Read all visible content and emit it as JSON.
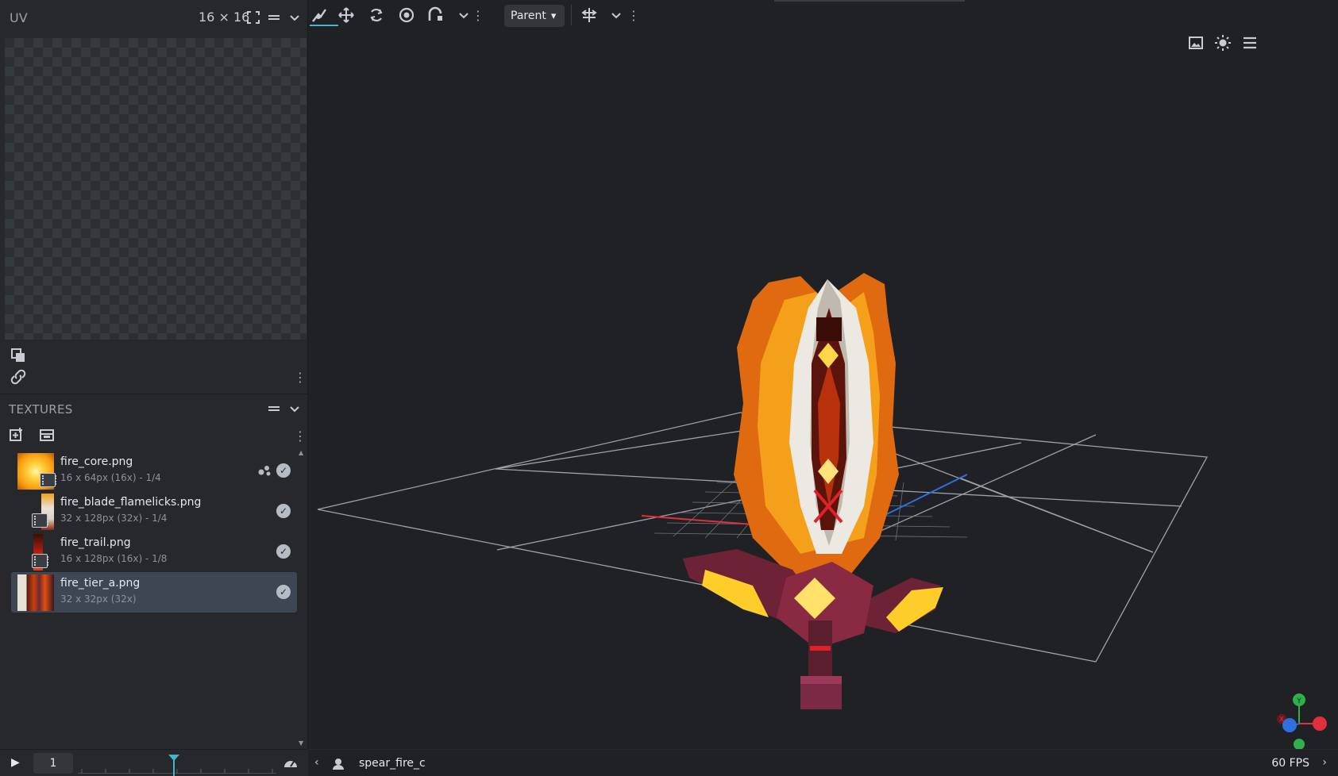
{
  "uv_panel": {
    "title": "UV",
    "size_label": "16 × 16"
  },
  "textures_panel": {
    "title": "TEXTURES",
    "items": [
      {
        "name": "fire_core.png",
        "meta": "16 x 64px (16x) - 1/4",
        "selected": false
      },
      {
        "name": "fire_blade_flamelicks.png",
        "meta": "32 x 128px (32x) - 1/4",
        "selected": false
      },
      {
        "name": "fire_trail.png",
        "meta": "16 x 128px (16x) - 1/8",
        "selected": false
      },
      {
        "name": "fire_tier_a.png",
        "meta": "32 x 32px (32x)",
        "selected": true
      }
    ]
  },
  "timeline": {
    "frame_value": "1",
    "playhead_fraction": 0.48
  },
  "toolbar": {
    "tools": [
      "pivot-tool-icon",
      "move-icon",
      "rotate-icon",
      "resize-center-icon",
      "vertex-snap-icon"
    ],
    "active_tool": "pivot-tool-icon",
    "space_select": "Parent"
  },
  "viewport": {
    "header_icons": [
      "image-icon",
      "brightness-icon",
      "menu-icon"
    ],
    "gizmo_axes": [
      "Y",
      "X"
    ]
  },
  "status_bar": {
    "model_name": "spear_fire_c",
    "fps": "60 FPS"
  },
  "colors": {
    "accent": "#3fb7c9",
    "panel": "#26282b",
    "viewport_bg": "#1f2124",
    "selected_row": "#3d4653",
    "axis_x": "#e0303d",
    "axis_y": "#2fb04d",
    "axis_z": "#2f6fe0"
  }
}
